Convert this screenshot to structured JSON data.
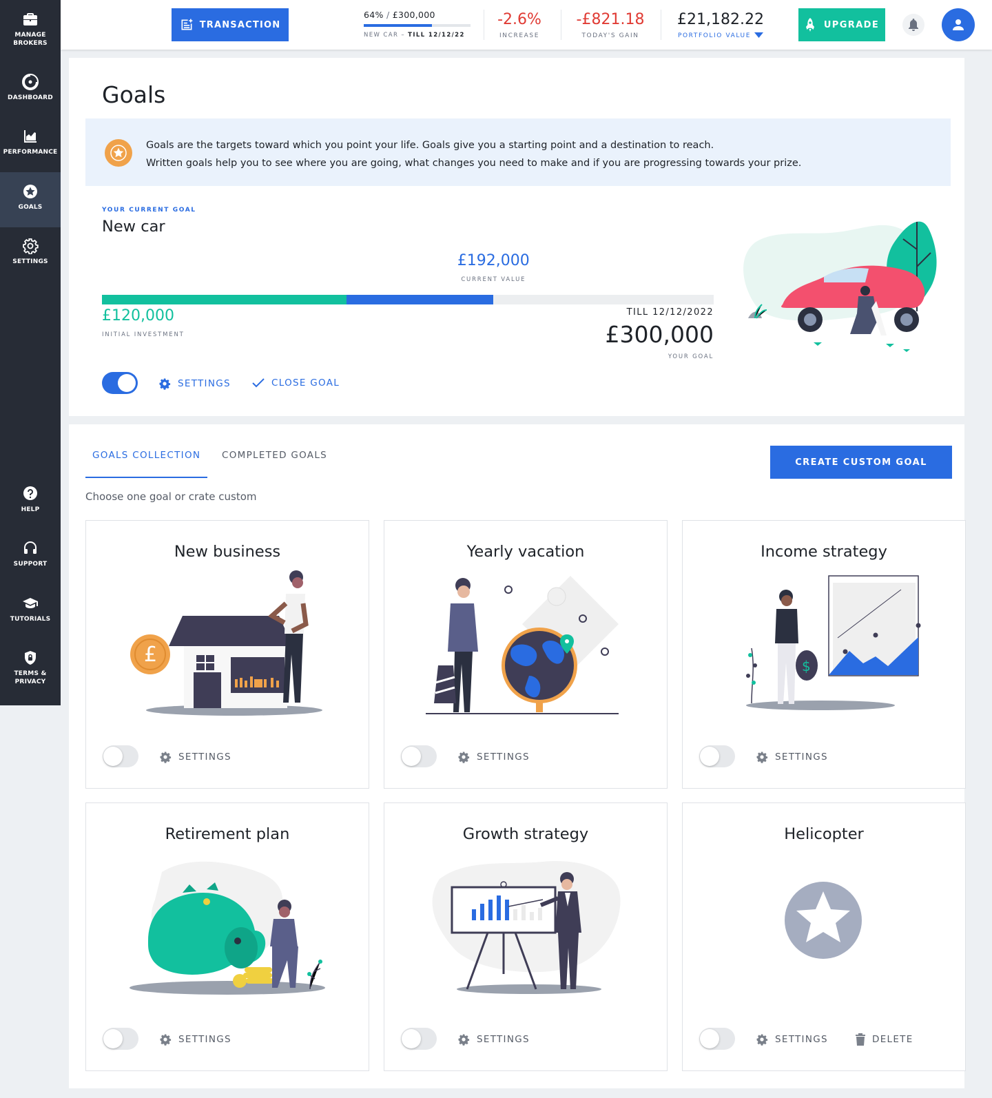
{
  "sidebar": {
    "items": [
      {
        "label": "Manage brokers",
        "icon": "briefcase-icon"
      },
      {
        "label": "Dashboard",
        "icon": "dashboard-icon"
      },
      {
        "label": "Performance",
        "icon": "chart-icon"
      },
      {
        "label": "Goals",
        "icon": "star-icon",
        "active": true
      },
      {
        "label": "Settings",
        "icon": "gear-icon"
      },
      {
        "label": "Help",
        "icon": "help-icon"
      },
      {
        "label": "Support",
        "icon": "headset-icon"
      },
      {
        "label": "Tutorials",
        "icon": "graduation-cap-icon"
      },
      {
        "label": "Terms & Privacy",
        "icon": "shield-lock-icon"
      }
    ]
  },
  "topbar": {
    "transaction_label": "TRANSACTION",
    "goal_progress": {
      "percent_text": "64%",
      "separator": "/",
      "target": "£300,000",
      "fill_fraction": 0.64,
      "goal_name": "NEW CAR –",
      "till": "TILL 12/12/22"
    },
    "increase": {
      "value": "-2.6%",
      "label": "INCREASE"
    },
    "todays_gain": {
      "value": "-£821.18",
      "label": "TODAY'S GAIN"
    },
    "portfolio": {
      "value": "£21,182.22",
      "label": "PORTFOLIO VALUE"
    },
    "upgrade_label": "UPGRADE"
  },
  "goals_page": {
    "title": "Goals",
    "info_line1": "Goals are the targets toward which you point your life. Goals give you a starting point and a destination to reach.",
    "info_line2": "Written goals help you to see where you are going, what changes you need to make and if you are progressing towards your prize.",
    "current_goal": {
      "eyebrow": "YOUR CURRENT GOAL",
      "name": "New car",
      "current_value": "£192,000",
      "current_value_label": "CURRENT VALUE",
      "initial_investment": "£120,000",
      "initial_investment_label": "INITIAL INVESTMENT",
      "till": "TILL 12/12/2022",
      "goal_value": "£300,000",
      "goal_label": "YOUR GOAL",
      "initial_fraction": 0.4,
      "current_fraction": 0.64,
      "settings_label": "SETTINGS",
      "close_label": "CLOSE GOAL"
    }
  },
  "collection": {
    "tabs": [
      "GOALS COLLECTION",
      "COMPLETED GOALS"
    ],
    "create_label": "CREATE CUSTOM GOAL",
    "subtitle": "Choose one goal or crate custom",
    "settings_label": "SETTINGS",
    "delete_label": "DELETE",
    "cards": [
      {
        "title": "New business"
      },
      {
        "title": "Yearly vacation"
      },
      {
        "title": "Income strategy"
      },
      {
        "title": "Retirement plan"
      },
      {
        "title": "Growth strategy"
      },
      {
        "title": "Helicopter"
      }
    ]
  },
  "colors": {
    "accent": "#2a6ce1",
    "green": "#12c09e",
    "negative": "#e03b34",
    "sidebar": "#272c36"
  }
}
